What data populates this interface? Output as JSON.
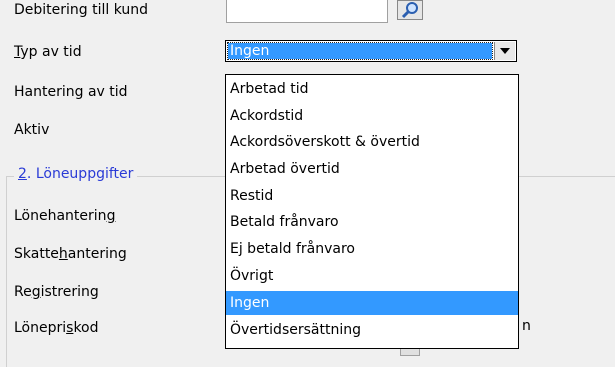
{
  "form": {
    "labels": {
      "debitering": "Debitering till kund",
      "typ_pre": "",
      "typ_u": "T",
      "typ_post": "yp av tid",
      "hantering": "Hantering av tid",
      "aktiv": "Aktiv"
    },
    "section2": {
      "number": "2",
      "title": ". Löneuppgifter"
    },
    "section2_labels": {
      "lonehantering_pre": "Lönehanterin",
      "lonehantering_u": "g",
      "lonehantering_post": "",
      "skatte_pre": "Skatte",
      "skatte_u": "h",
      "skatte_post": "antering",
      "registrering_pre": "Re",
      "registrering_u": "g",
      "registrering_post": "istrering",
      "loneprisk_pre": "Lönepri",
      "loneprisk_u": "s",
      "loneprisk_post": "kod"
    },
    "right_fragment_text": "n"
  },
  "combo": {
    "selected": "Ingen",
    "options": [
      "Arbetad tid",
      "Ackordstid",
      "Ackordsöverskott & övertid",
      "Arbetad övertid",
      "Restid",
      "Betald frånvaro",
      "Ej betald frånvaro",
      "Övrigt",
      "Ingen",
      "Övertidsersättning"
    ],
    "highlighted_index": 8
  },
  "colors": {
    "highlight": "#3399ff",
    "section_title": "#2a3bd6"
  },
  "icons": {
    "search_button": "magnifier-icon",
    "combo_button": "chevron-down-icon"
  }
}
